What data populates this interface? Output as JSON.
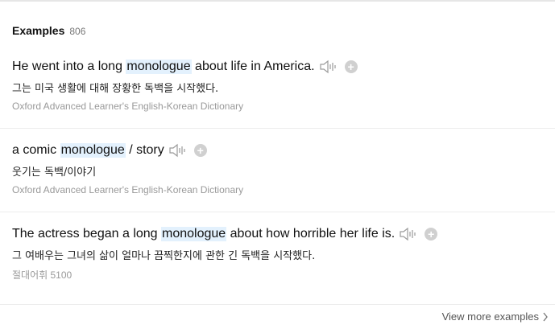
{
  "header": {
    "title": "Examples",
    "count": "806"
  },
  "examples": [
    {
      "before": "He went into a long ",
      "highlight": "monologue",
      "after": " about life in America.",
      "translation": "그는 미국 생활에 대해 장황한 독백을 시작했다.",
      "source": "Oxford Advanced Learner's English-Korean Dictionary"
    },
    {
      "before": "a comic ",
      "highlight": "monologue",
      "after": " / story",
      "translation": "웃기는 독백/이야기",
      "source": "Oxford Advanced Learner's English-Korean Dictionary"
    },
    {
      "before": "The actress began a long ",
      "highlight": "monologue",
      "after": " about how horrible her life is.",
      "translation": "그 여배우는 그녀의 삶이 얼마나 끔찍한지에 관한 긴 독백을 시작했다.",
      "source": "절대어휘 5100"
    }
  ],
  "footer": {
    "view_more": "View more examples"
  },
  "icons": {
    "speaker": "speaker-icon",
    "add": "plus-circle-icon",
    "chevron": "chevron-right-icon"
  },
  "colors": {
    "highlight": "#e3f1fd",
    "icon": "#9a9a9a",
    "add_bg": "#d0d0d0"
  }
}
